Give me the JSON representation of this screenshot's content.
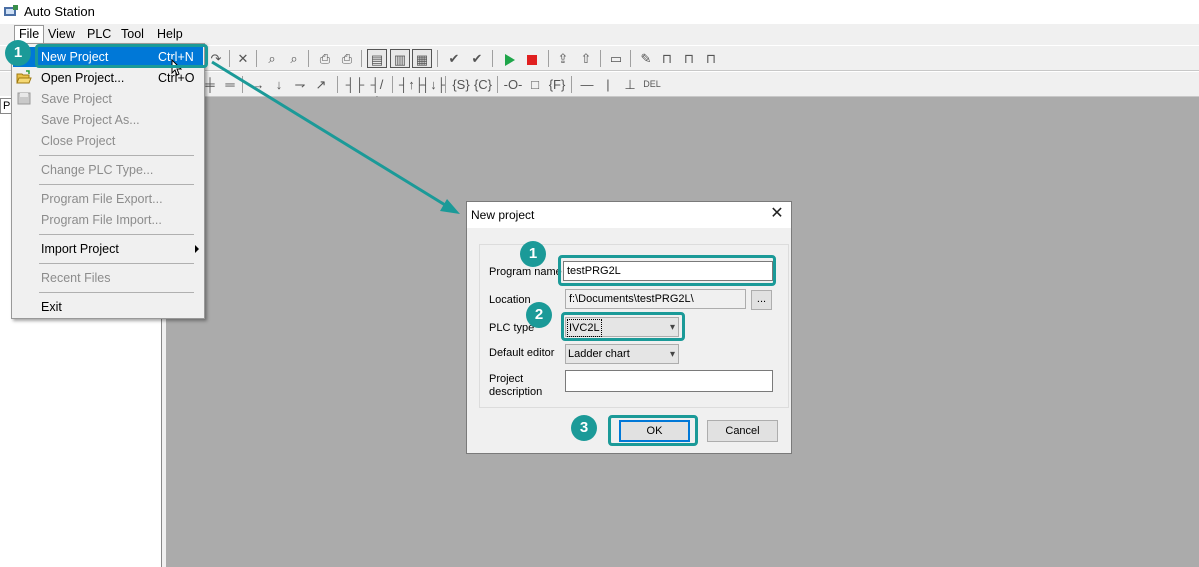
{
  "app": {
    "title": "Auto Station"
  },
  "menubar": [
    "File",
    "View",
    "PLC",
    "Tool",
    "Help"
  ],
  "file_menu": {
    "items": [
      {
        "label": "New Project",
        "shortcut": "Ctrl+N",
        "state": "highlighted"
      },
      {
        "label": "Open Project...",
        "shortcut": "Ctrl+O",
        "state": "enabled"
      },
      {
        "label": "Save Project",
        "state": "disabled"
      },
      {
        "label": "Save Project As...",
        "state": "disabled"
      },
      {
        "label": "Close Project",
        "state": "disabled"
      },
      {
        "label": "Change PLC Type...",
        "state": "disabled"
      },
      {
        "label": "Program File Export...",
        "state": "disabled"
      },
      {
        "label": "Program File Import...",
        "state": "disabled"
      },
      {
        "label": "Import Project",
        "state": "enabled",
        "submenu": true
      },
      {
        "label": "Recent Files",
        "state": "disabled"
      },
      {
        "label": "Exit",
        "state": "enabled"
      }
    ]
  },
  "left_panel": {
    "tab": "P"
  },
  "dialog": {
    "title": "New project",
    "close_glyph": "✕",
    "fields": {
      "program_name_label": "Program name",
      "program_name_value": "testPRG2L",
      "location_label": "Location",
      "location_value": "f:\\Documents\\testPRG2L\\",
      "browse_label": "...",
      "plc_type_label": "PLC type",
      "plc_type_value": "IVC2L",
      "default_editor_label": "Default editor",
      "default_editor_value": "Ladder chart",
      "project_description_label": "Project description",
      "project_description_value": ""
    },
    "buttons": {
      "ok": "OK",
      "cancel": "Cancel"
    }
  },
  "annotations": {
    "menu_step": "1",
    "dialog_steps": [
      "1",
      "2",
      "3"
    ],
    "accent_color": "#1b9a98"
  },
  "toolbar_glyphs": {
    "row1": [
      "✂",
      "⎘",
      "✕",
      "⚲",
      "⚲",
      "⎙",
      "⎙",
      "✔",
      "✔",
      "▶",
      "■",
      "⇪",
      "⇧",
      "▭",
      "✎",
      "🔒",
      "🔒",
      "🔒"
    ],
    "row2": [
      "╪",
      "═",
      "→",
      "↓",
      "⇁",
      "↗",
      "┤├",
      "┤/├",
      "┤↑├",
      "┤↓├",
      "{S}",
      "{C}",
      "-O-",
      "□",
      "{F}",
      "—",
      "|",
      "⊥",
      "DEL"
    ]
  },
  "colors": {
    "workspace": "#ababab",
    "highlight": "#0078d7",
    "play": "#1fa64a",
    "stop": "#e02020"
  }
}
